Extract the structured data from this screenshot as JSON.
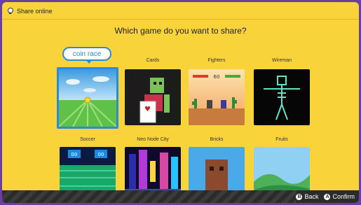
{
  "header": {
    "title": "Share online"
  },
  "prompt": "Which game do you want to share?",
  "tooltip": "coin race",
  "games": [
    {
      "label": "coin race"
    },
    {
      "label": "Cards"
    },
    {
      "label": "Fighters"
    },
    {
      "label": "Wireman"
    },
    {
      "label": "Soccer"
    },
    {
      "label": "Neo Node City"
    },
    {
      "label": "Bricks"
    },
    {
      "label": "Fruits"
    }
  ],
  "fighters_score": "60",
  "soccer_scores": [
    "00",
    "00"
  ],
  "controls": {
    "back_label": "Back",
    "back_button": "B",
    "confirm_label": "Confirm",
    "confirm_button": "A"
  },
  "colors": {
    "accent": "#2a8bd8",
    "background": "#f8d33a",
    "frame": "#6b3fa0"
  }
}
